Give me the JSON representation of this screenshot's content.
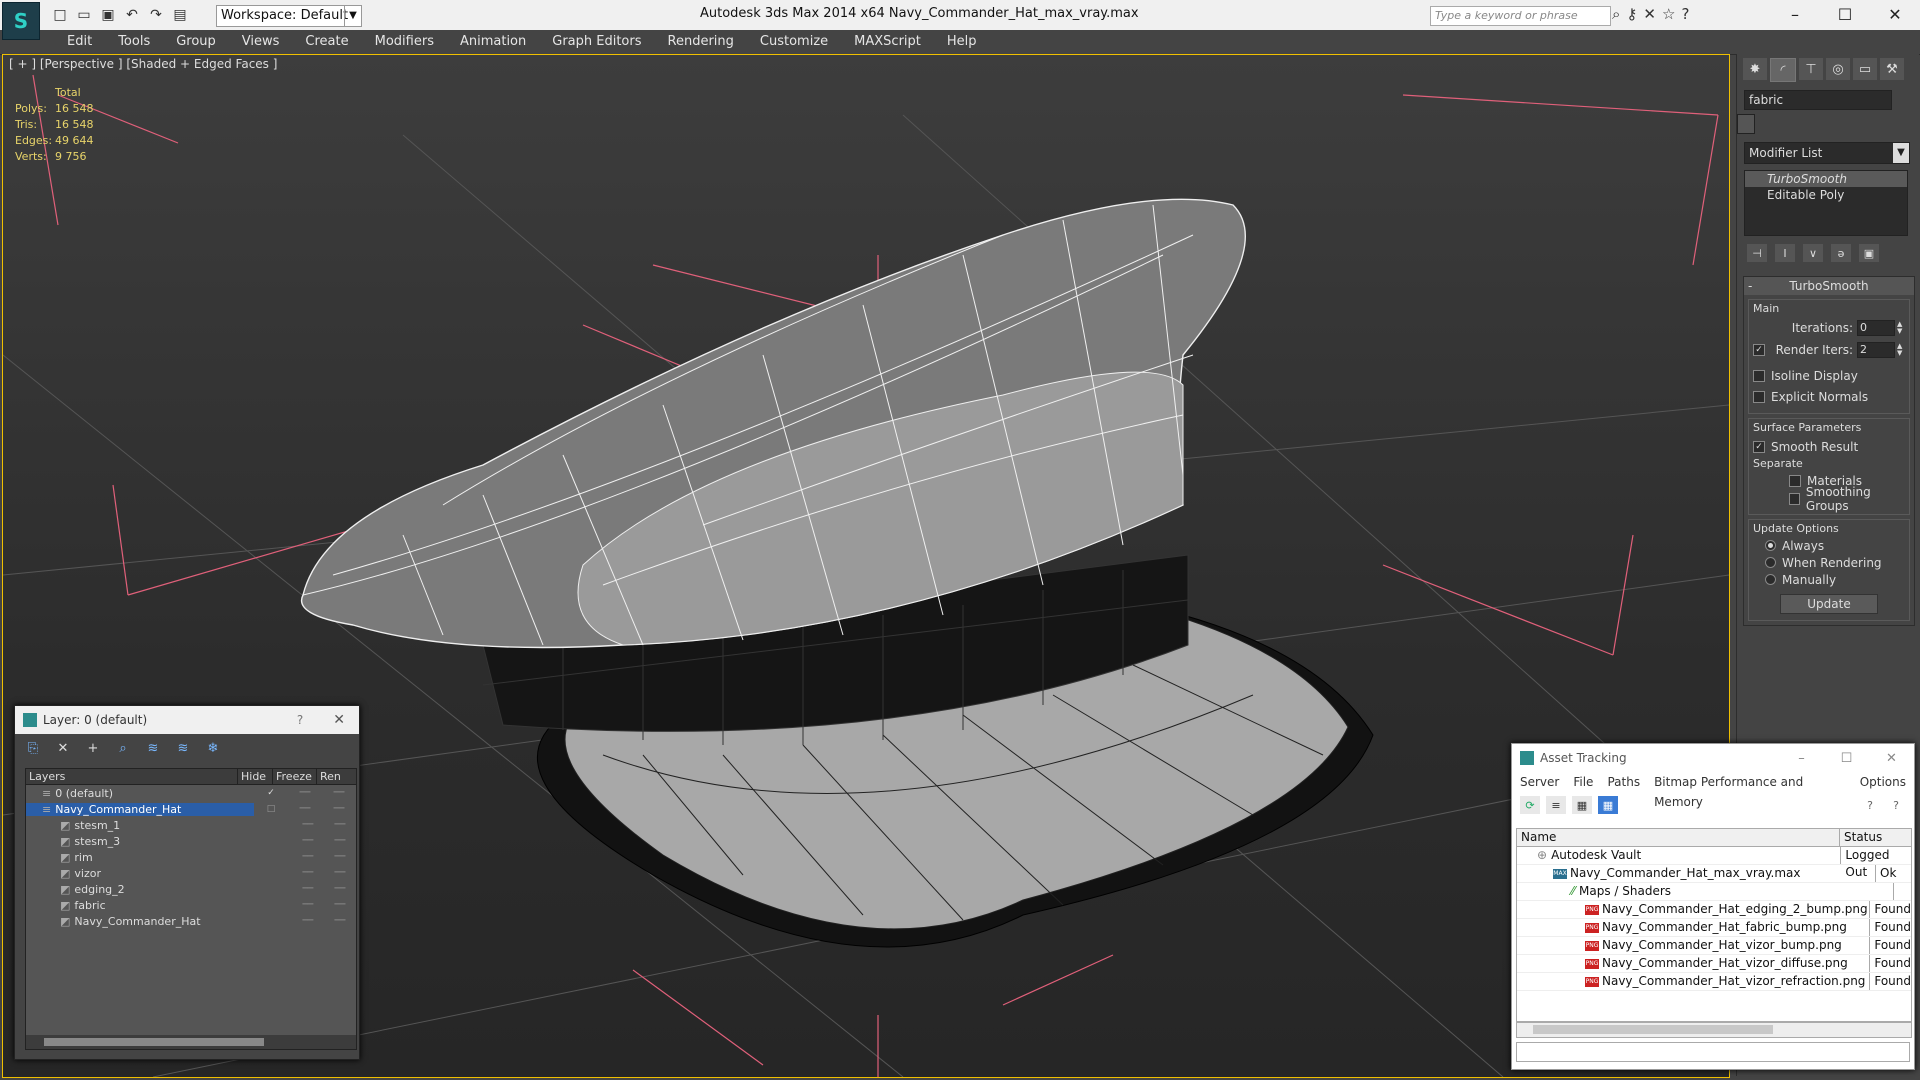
{
  "app": {
    "logo": "S",
    "title": "Autodesk 3ds Max  2014 x64      Navy_Commander_Hat_max_vray.max",
    "workspace": "Workspace: Default",
    "search_placeholder": "Type a keyword or phrase"
  },
  "menu": [
    "Edit",
    "Tools",
    "Group",
    "Views",
    "Create",
    "Modifiers",
    "Animation",
    "Graph Editors",
    "Rendering",
    "Customize",
    "MAXScript",
    "Help"
  ],
  "viewport": {
    "label": "[ + ] [Perspective ] [Shaded + Edged Faces ]",
    "stats_header": "Total",
    "stats": [
      {
        "k": "Polys:",
        "v": "16 548"
      },
      {
        "k": "Tris:",
        "v": "16 548"
      },
      {
        "k": "Edges:",
        "v": "49 644"
      },
      {
        "k": "Verts:",
        "v": "9 756"
      }
    ]
  },
  "command_panel": {
    "object_name": "fabric",
    "modifier_list": "Modifier List",
    "stack": [
      "TurboSmooth",
      "Editable Poly"
    ],
    "rollout_title": "TurboSmooth",
    "main_label": "Main",
    "iterations_label": "Iterations:",
    "iterations_value": "0",
    "render_iters_label": "Render Iters:",
    "render_iters_value": "2",
    "isoline": "Isoline Display",
    "explicit": "Explicit Normals",
    "surface_label": "Surface Parameters",
    "smooth_result": "Smooth Result",
    "separate_label": "Separate",
    "materials": "Materials",
    "smoothing_groups": "Smoothing Groups",
    "update_options_label": "Update Options",
    "always": "Always",
    "when_rendering": "When Rendering",
    "manually": "Manually",
    "update_btn": "Update"
  },
  "layer_window": {
    "title": "Layer: 0 (default)",
    "help": "?",
    "columns": [
      "Layers",
      "Hide",
      "Freeze",
      "Ren"
    ],
    "rows": [
      {
        "name": "0 (default)",
        "indent": 0
      },
      {
        "name": "Navy_Commander_Hat",
        "indent": 0
      },
      {
        "name": "stesm_1",
        "indent": 1
      },
      {
        "name": "stesm_3",
        "indent": 1
      },
      {
        "name": "rim",
        "indent": 1
      },
      {
        "name": "vizor",
        "indent": 1
      },
      {
        "name": "edging_2",
        "indent": 1
      },
      {
        "name": "fabric",
        "indent": 1
      },
      {
        "name": "Navy_Commander_Hat",
        "indent": 1
      }
    ]
  },
  "asset_window": {
    "title": "Asset Tracking",
    "menu": [
      "Server",
      "File",
      "Paths",
      "Bitmap Performance and Memory",
      "Options"
    ],
    "columns": [
      "Name",
      "Status"
    ],
    "rows": [
      {
        "name": "Autodesk Vault",
        "status": "Logged Out",
        "indent": 0,
        "icon": "vault"
      },
      {
        "name": "Navy_Commander_Hat_max_vray.max",
        "status": "Ok",
        "indent": 1,
        "icon": "max"
      },
      {
        "name": "Maps / Shaders",
        "status": "",
        "indent": 2,
        "icon": "folder"
      },
      {
        "name": "Navy_Commander_Hat_edging_2_bump.png",
        "status": "Found",
        "indent": 3,
        "icon": "png"
      },
      {
        "name": "Navy_Commander_Hat_fabric_bump.png",
        "status": "Found",
        "indent": 3,
        "icon": "png"
      },
      {
        "name": "Navy_Commander_Hat_vizor_bump.png",
        "status": "Found",
        "indent": 3,
        "icon": "png"
      },
      {
        "name": "Navy_Commander_Hat_vizor_diffuse.png",
        "status": "Found",
        "indent": 3,
        "icon": "png"
      },
      {
        "name": "Navy_Commander_Hat_vizor_refraction.png",
        "status": "Found",
        "indent": 3,
        "icon": "png"
      }
    ]
  }
}
